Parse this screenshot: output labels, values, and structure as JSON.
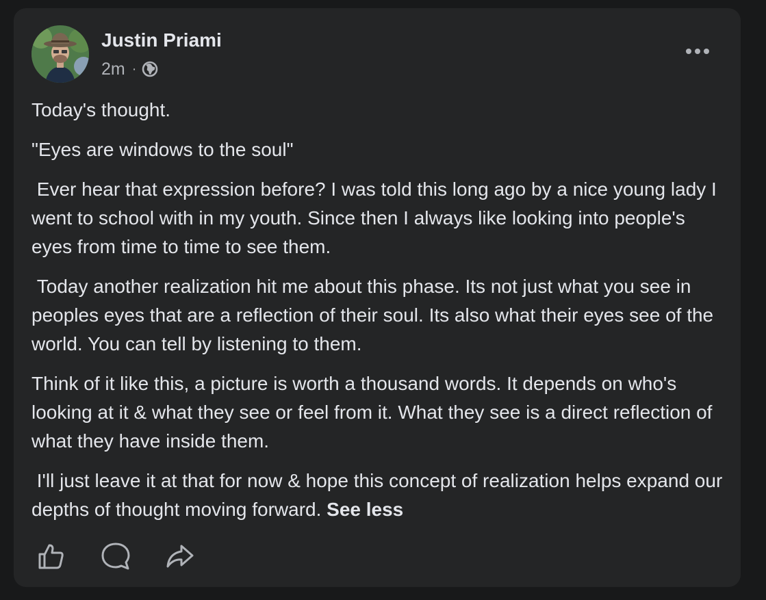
{
  "post": {
    "author": {
      "name": "Justin Priami"
    },
    "timestamp": "2m",
    "separator": "·",
    "privacy_icon": "globe-icon",
    "more_icon": "more-options-icon",
    "paragraphs": [
      "Today's thought.",
      "\"Eyes are windows to the soul\"",
      " Ever hear that expression before? I was told this long ago by a nice young lady I went to school with in my youth. Since then I always like looking into people's eyes from time to time to see them.",
      " Today another realization hit me about this phase. Its not just what you see in peoples eyes that are a reflection of their soul. Its also what their eyes see of the world. You can tell by listening to them.",
      "Think of it like this, a picture is worth a thousand words. It depends on who's looking at it & what they see or feel from it. What they see is a direct reflection of what they have inside them.",
      " I'll just leave it at that for now & hope this concept of realization helps expand our depths of thought moving forward. "
    ],
    "see_less_label": "See less",
    "actions": {
      "like_icon": "thumbs-up-icon",
      "comment_icon": "comment-icon",
      "share_icon": "share-icon"
    }
  },
  "colors": {
    "page_background": "#18191a",
    "card_background": "#242526",
    "primary_text": "#e4e6eb",
    "secondary_text": "#b0b3b8"
  }
}
